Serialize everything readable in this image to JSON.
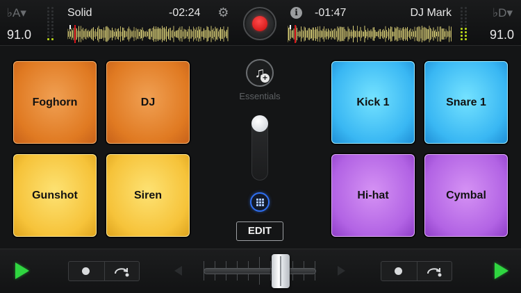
{
  "deck_a": {
    "key": "♭A▾",
    "bpm": "91.0",
    "track_title": "Solid",
    "time_remaining": "-02:24"
  },
  "deck_b": {
    "key": "♭D▾",
    "bpm": "91.0",
    "track_title": "DJ Mark",
    "time_remaining": "-01:47"
  },
  "header": {
    "settings_icon": "gear-icon",
    "info_icon": "info-icon",
    "info_glyph": "i",
    "record_icon": "record-icon",
    "record_color": "#d9141b"
  },
  "sampler": {
    "bank_icon": "music-note-plus-icon",
    "bank_label": "Essentials",
    "edit_label": "EDIT",
    "left_pads": [
      {
        "label": "Foghorn",
        "color": "#e88a2f"
      },
      {
        "label": "DJ",
        "color": "#e88a2f"
      },
      {
        "label": "Gunshot",
        "color": "#f8cf48"
      },
      {
        "label": "Siren",
        "color": "#f8cf48"
      }
    ],
    "right_pads": [
      {
        "label": "Kick 1",
        "color": "#48c4f7"
      },
      {
        "label": "Snare 1",
        "color": "#48c4f7"
      },
      {
        "label": "Hi-hat",
        "color": "#bf72ea"
      },
      {
        "label": "Cymbal",
        "color": "#bf72ea"
      }
    ]
  },
  "transport": {
    "play_color": "#2fd640",
    "left_controls": [
      "cue-dot-icon",
      "loop-arrow-icon"
    ],
    "right_controls": [
      "cue-dot-icon",
      "loop-arrow-icon"
    ]
  },
  "crossfader": {
    "position_fraction": 0.6
  }
}
